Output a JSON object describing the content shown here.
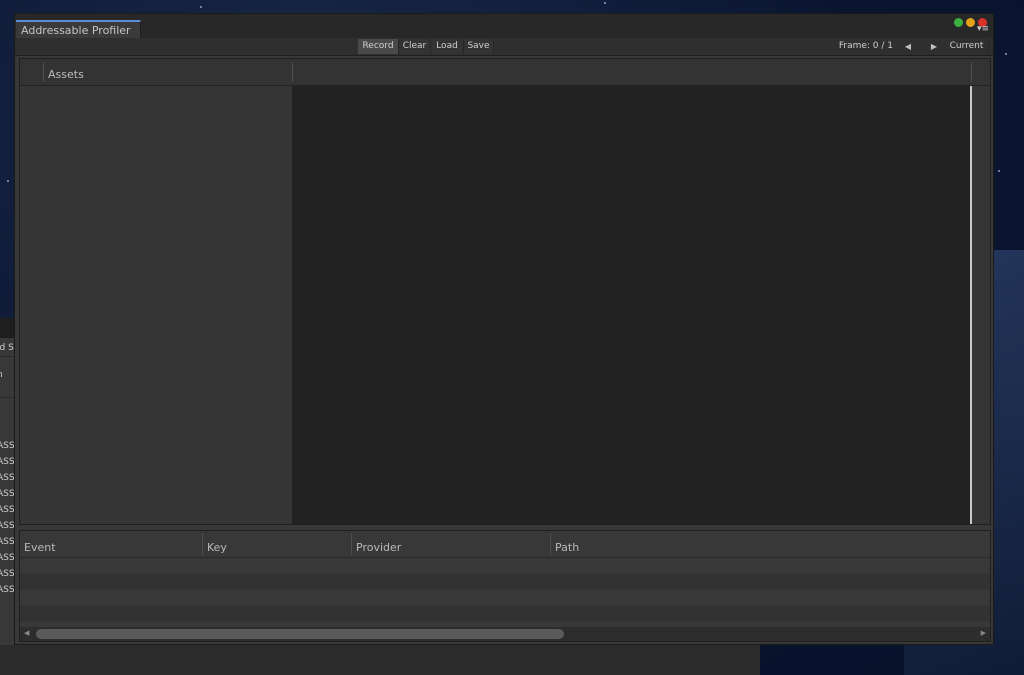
{
  "window": {
    "tab_title": "Addressable Profiler",
    "controls": {
      "green": "#3cb043",
      "yellow": "#e3a21a",
      "red": "#d9302a"
    }
  },
  "toolbar": {
    "record": "Record",
    "clear": "Clear",
    "load": "Load",
    "save": "Save",
    "frame": "Frame: 0 / 1",
    "current": "Current"
  },
  "assets_panel": {
    "header": "Assets"
  },
  "events_table": {
    "columns": [
      "Event",
      "Key",
      "Provider",
      "Path"
    ]
  },
  "left_panel": {
    "labels": [
      "ld S",
      "n"
    ],
    "rows": [
      "ASS",
      "ASS",
      "ASS",
      "ASS",
      "ASS",
      "ASS",
      "ASS",
      "ASS",
      "ASS",
      "ASS"
    ]
  }
}
